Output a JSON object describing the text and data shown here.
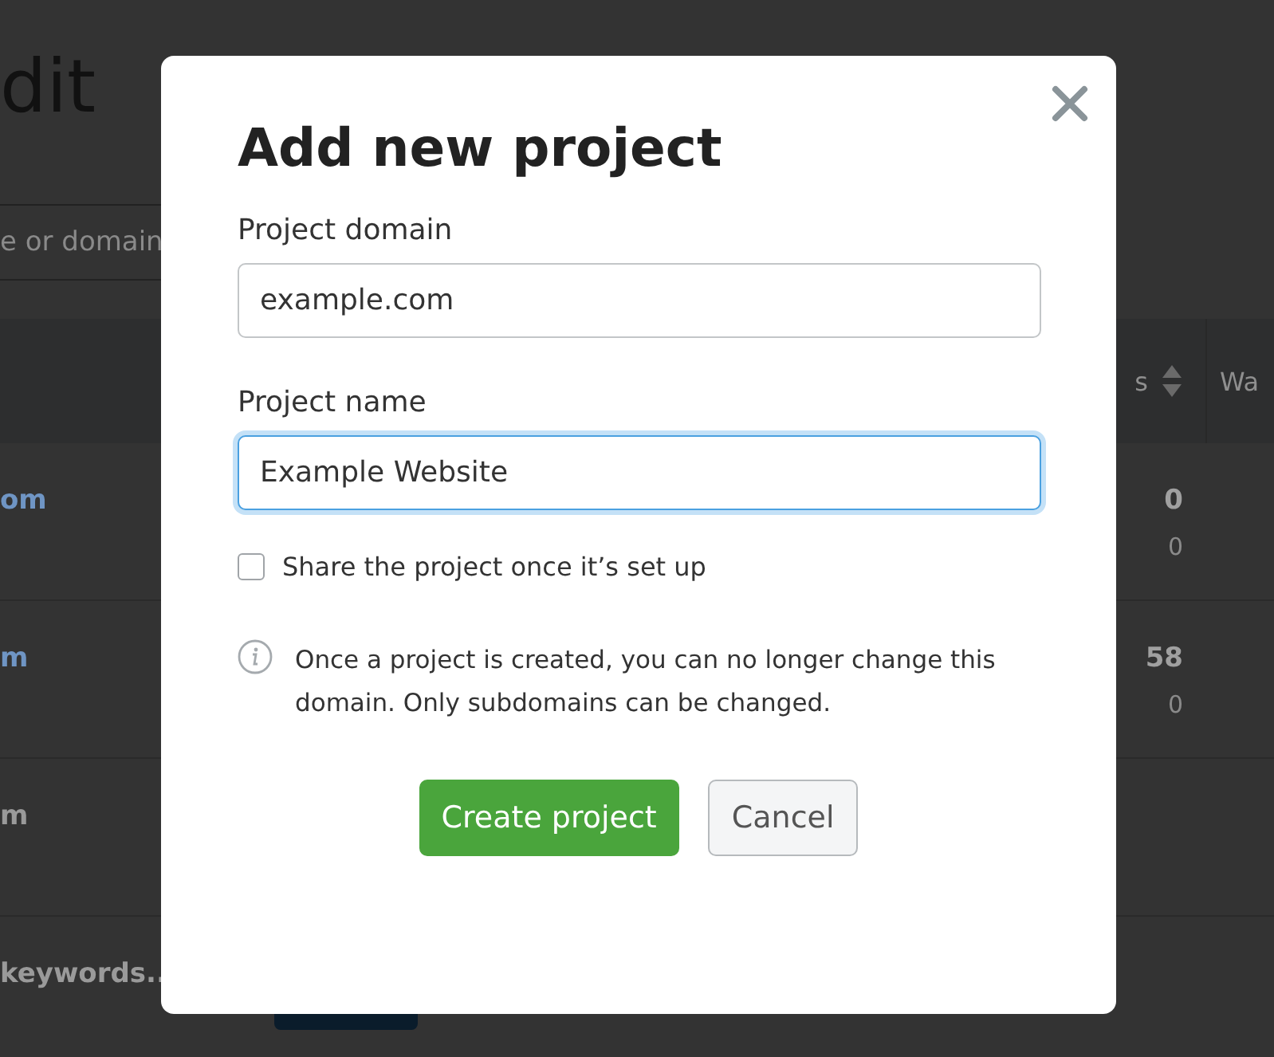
{
  "background": {
    "title": "dit",
    "search": {
      "placeholder": "e or domain"
    },
    "header": {
      "column_1": "s",
      "column_2": "Wa"
    },
    "rows": [
      {
        "kind": "link",
        "name": "om",
        "value": "0",
        "sub": "0"
      },
      {
        "kind": "link",
        "name": "m",
        "value": "58",
        "sub": "0"
      },
      {
        "kind": "text",
        "name": "m"
      },
      {
        "kind": "text",
        "name": "keywords.."
      }
    ]
  },
  "dialog": {
    "title": "Add new project",
    "fields": [
      {
        "label": "Project domain",
        "value": "example.com",
        "focused": false
      },
      {
        "label": "Project name",
        "value": "Example Website",
        "focused": true
      }
    ],
    "share": {
      "label": "Share the project once it’s set up",
      "checked": false
    },
    "note": "Once a project is created, you can no longer change this domain. Only subdomains can be changed.",
    "buttons": [
      {
        "label": "Create project",
        "kind": "primary"
      },
      {
        "label": "Cancel",
        "kind": "secondary"
      }
    ]
  }
}
